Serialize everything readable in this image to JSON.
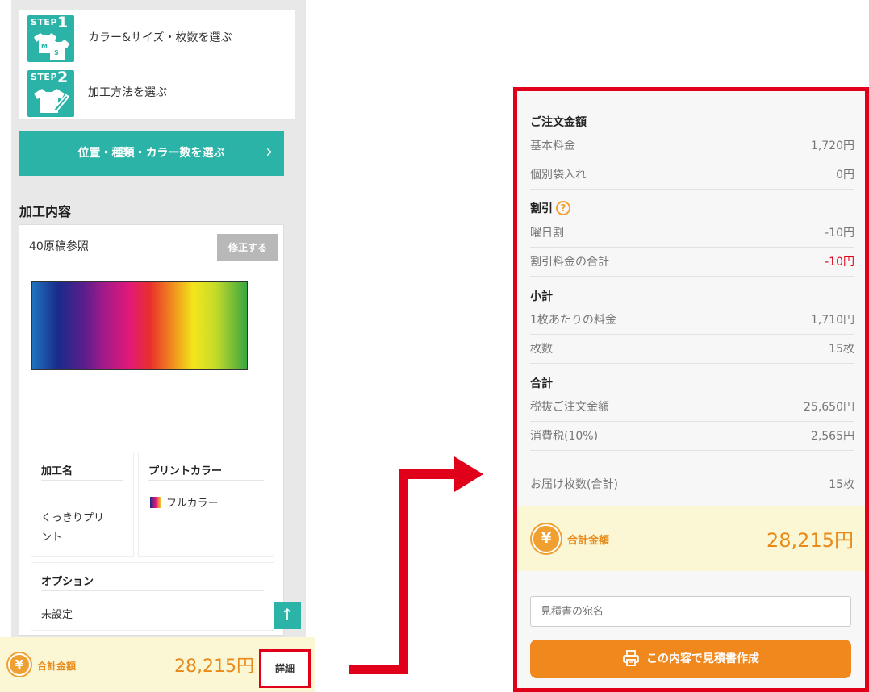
{
  "steps": [
    {
      "word": "STEP",
      "num": "1",
      "label": "カラー&サイズ・枚数を選ぶ",
      "shirt_marks": [
        "M",
        "S"
      ]
    },
    {
      "word": "STEP",
      "num": "2",
      "label": "加工方法を選ぶ"
    }
  ],
  "process_button": {
    "label": "位置・種類・カラー数を選ぶ",
    "chevron": "›"
  },
  "process_section_title": "加工内容",
  "design": {
    "name": "40原稿参照",
    "edit_label": "修正する",
    "process_name_head": "加工名",
    "process_name_value": "くっきりプリント",
    "print_color_head": "プリントカラー",
    "print_color_value": "フルカラー",
    "option_head": "オプション",
    "option_value": "未設定"
  },
  "scroll_top_glyph": "↑",
  "left_total": {
    "yen": "¥",
    "label": "合計金額",
    "amount": "28,215円",
    "detail_label": "詳細"
  },
  "summary": {
    "order_title": "ご注文金額",
    "base_fee": {
      "label": "基本料金",
      "value": "1,720円"
    },
    "bag": {
      "label": "個別袋入れ",
      "value": "0円"
    },
    "discount_title": "割引",
    "help_glyph": "?",
    "weekday": {
      "label": "曜日割",
      "value": "-10円"
    },
    "discount_total": {
      "label": "割引料金の合計",
      "value": "-10円"
    },
    "subtotal_title": "小計",
    "per_item": {
      "label": "1枚あたりの料金",
      "value": "1,710円"
    },
    "count": {
      "label": "枚数",
      "value": "15枚"
    },
    "total_title": "合計",
    "pre_tax": {
      "label": "税抜ご注文金額",
      "value": "25,650円"
    },
    "tax": {
      "label": "消費税(10%)",
      "value": "2,565円"
    },
    "delivery_count": {
      "label": "お届け枚数(合計)",
      "value": "15枚"
    }
  },
  "right_total": {
    "yen": "¥",
    "label": "合計金額",
    "amount": "28,215円"
  },
  "estimate": {
    "placeholder": "見積書の宛名",
    "button_label": "この内容で見積書作成"
  },
  "colors": {
    "teal": "#2bb3a8",
    "orange": "#f0881e",
    "red": "#e0001a",
    "cream": "#fbf6d3"
  }
}
